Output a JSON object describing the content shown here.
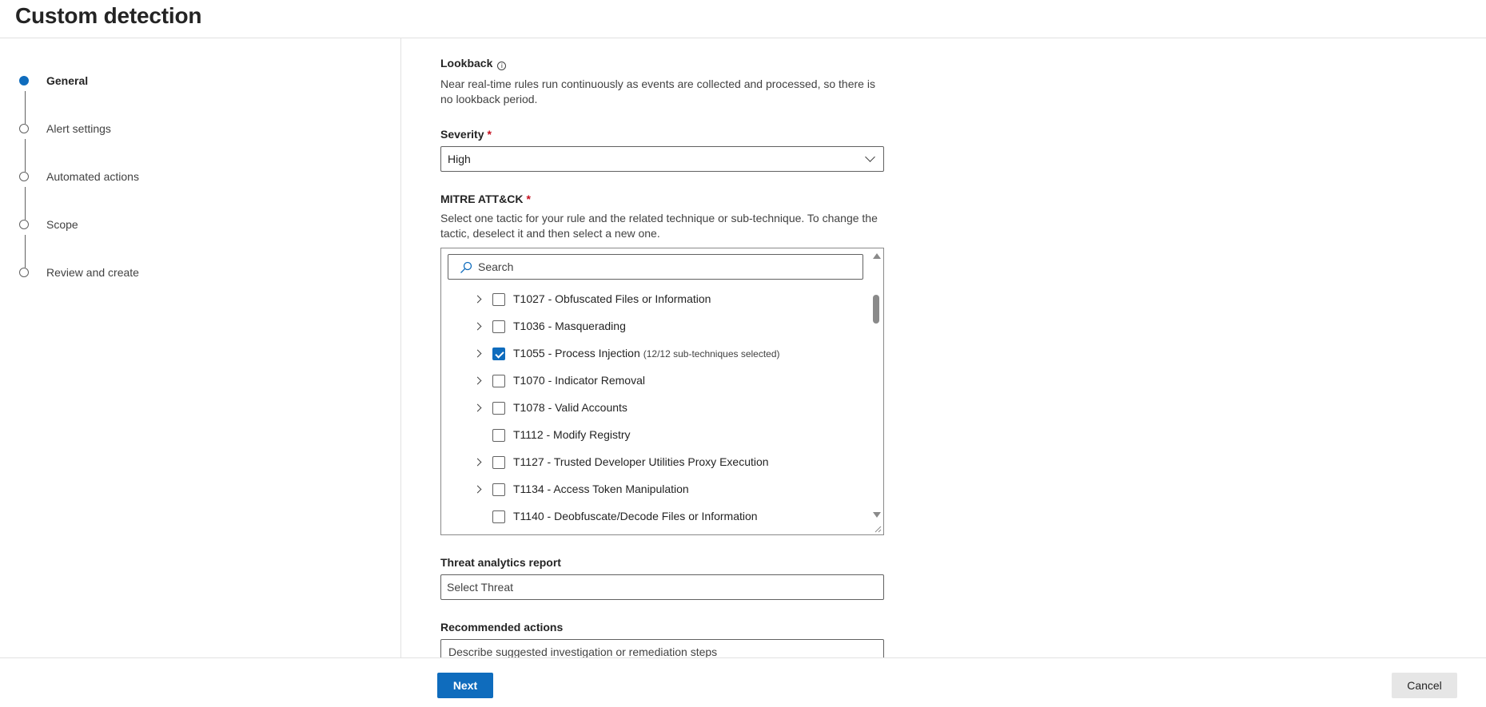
{
  "page": {
    "title": "Custom detection"
  },
  "wizard": {
    "steps": [
      {
        "label": "General",
        "active": true
      },
      {
        "label": "Alert settings",
        "active": false
      },
      {
        "label": "Automated actions",
        "active": false
      },
      {
        "label": "Scope",
        "active": false
      },
      {
        "label": "Review and create",
        "active": false
      }
    ]
  },
  "form": {
    "lookback": {
      "label": "Lookback",
      "info_icon": "i",
      "description": "Near real-time rules run continuously as events are collected and processed, so there is no lookback period."
    },
    "severity": {
      "label": "Severity",
      "required_mark": "*",
      "value": "High"
    },
    "mitre": {
      "label": "MITRE ATT&CK",
      "required_mark": "*",
      "description": "Select one tactic for your rule and the related technique or sub-technique. To change the tactic, deselect it and then select a new one.",
      "search_placeholder": "Search",
      "items": [
        {
          "label": "T1027 - Obfuscated Files or Information",
          "sub": "",
          "checked": false,
          "expandable": true
        },
        {
          "label": "T1036 - Masquerading",
          "sub": "",
          "checked": false,
          "expandable": true
        },
        {
          "label": "T1055 - Process Injection",
          "sub": "(12/12 sub-techniques selected)",
          "checked": true,
          "expandable": true
        },
        {
          "label": "T1070 - Indicator Removal",
          "sub": "",
          "checked": false,
          "expandable": true
        },
        {
          "label": "T1078 - Valid Accounts",
          "sub": "",
          "checked": false,
          "expandable": true
        },
        {
          "label": "T1112 - Modify Registry",
          "sub": "",
          "checked": false,
          "expandable": false
        },
        {
          "label": "T1127 - Trusted Developer Utilities Proxy Execution",
          "sub": "",
          "checked": false,
          "expandable": true
        },
        {
          "label": "T1134 - Access Token Manipulation",
          "sub": "",
          "checked": false,
          "expandable": true
        },
        {
          "label": "T1140 - Deobfuscate/Decode Files or Information",
          "sub": "",
          "checked": false,
          "expandable": false
        }
      ]
    },
    "threat_report": {
      "label": "Threat analytics report",
      "value": "Select Threat"
    },
    "recommended_actions": {
      "label": "Recommended actions",
      "placeholder": "Describe suggested investigation or remediation steps"
    }
  },
  "footer": {
    "next_label": "Next",
    "cancel_label": "Cancel"
  },
  "colors": {
    "accent": "#0f6cbd",
    "required": "#c50f1f",
    "border": "#616161"
  }
}
